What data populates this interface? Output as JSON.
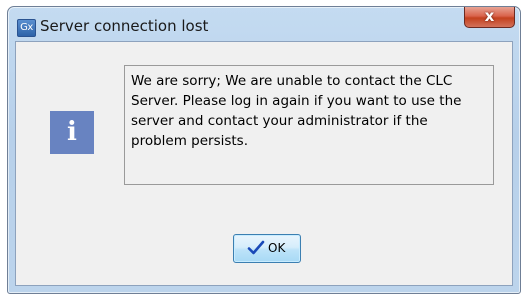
{
  "window": {
    "title": "Server connection lost",
    "app_icon_text": "Gx",
    "close_label": "x"
  },
  "dialog": {
    "info_icon_glyph": "i",
    "message": "We are sorry; We are unable to contact the CLC Server. Please log in again if you want to use the server and contact your administrator if the problem persists.",
    "ok_label": "OK"
  },
  "colors": {
    "info_icon_bg": "#6883c1",
    "check_mark": "#1a49b8"
  },
  "icons": {
    "app": "app-icon",
    "close": "close-icon",
    "info": "info-icon",
    "ok": "check-icon"
  }
}
